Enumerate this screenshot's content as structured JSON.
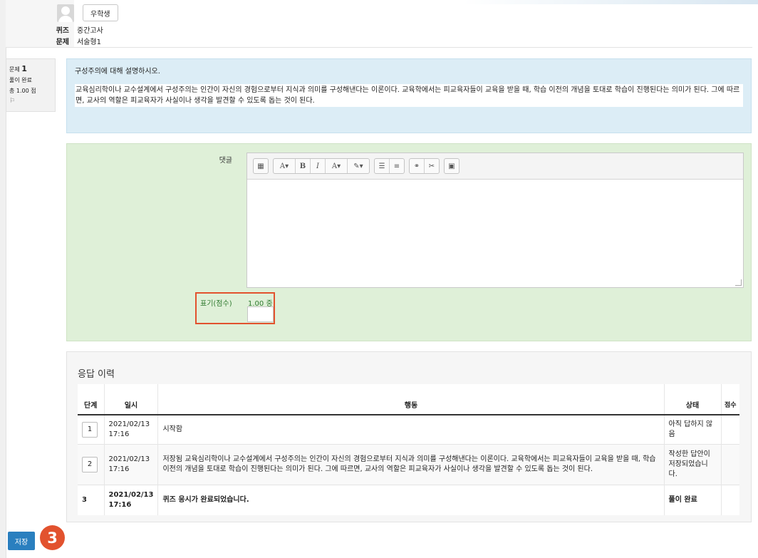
{
  "user": {
    "name": "우학생"
  },
  "info": {
    "quiz_label": "퀴즈",
    "quiz_value": "중간고사",
    "question_label": "문제",
    "question_value": "서술형1"
  },
  "qinfo": {
    "question_prefix": "문제",
    "question_number": "1",
    "state": "풀이 완료",
    "marks": "총 1.00 점",
    "flag": "⚐"
  },
  "question": {
    "prompt": "구성주의에 대해 설명하시오.",
    "answer": "교육심리학이나 교수설계에서 구성주의는 인간이 자신의 경험으로부터 지식과 의미를 구성해낸다는 이론이다. 교육학에서는 피교육자들이 교육을 받을 때, 학습 이전의 개념을 토대로 학습이 진행된다는 의미가 된다. 그에 따르면, 교사의 역할은 피교육자가 사실이나 생각을 발견할 수 있도록 돕는 것이 된다."
  },
  "comment": {
    "label": "댓글",
    "toolbar": [
      "▦",
      "A▾",
      "B",
      "I",
      "A▾",
      "✎▾",
      "☰",
      "≡",
      "⚭",
      "✂",
      "▣"
    ],
    "mark_label": "표기(점수)",
    "mark_max": "1.00 중"
  },
  "history": {
    "title": "응답 이력",
    "headers": [
      "단계",
      "일시",
      "행동",
      "상태",
      "점수"
    ],
    "rows": [
      {
        "step": "1",
        "date": "2021/02/13",
        "time": "17:16",
        "action": "시작함",
        "state": "아직 답하지 않음"
      },
      {
        "step": "2",
        "date": "2021/02/13",
        "time": "17:16",
        "action": "저장됨 교육심리학이나 교수설계에서 구성주의는 인간이 자신의 경험으로부터 지식과 의미를 구성해낸다는 이론이다. 교육학에서는 피교육자들이 교육을 받을 때, 학습 이전의 개념을 토대로 학습이 진행된다는 의미가 된다. 그에 따르면, 교사의 역할은 피교육자가 사실이나 생각을 발견할 수 있도록 돕는 것이 된다.",
        "state": "작성한 답안이 저장되었습니다."
      },
      {
        "step": "3",
        "date": "2021/02/13",
        "time": "17:16",
        "action": "퀴즈 응시가 완료되었습니다.",
        "state": "풀이 완료"
      }
    ]
  },
  "footer": {
    "save_label": "저장",
    "badge": "3"
  },
  "colors": {
    "highlight": "#e2522e",
    "save_button": "#2a7fbf",
    "question_bg": "#dcedf6",
    "comment_bg": "#dff0d8"
  }
}
